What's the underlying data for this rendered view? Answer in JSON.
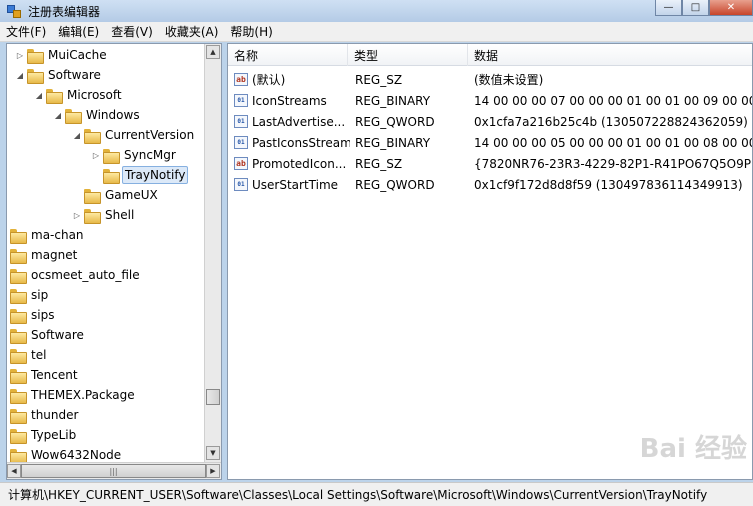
{
  "window": {
    "title": "注册表编辑器",
    "min": "—",
    "max": "□",
    "close": "✕"
  },
  "menu": [
    "文件(F)",
    "编辑(E)",
    "查看(V)",
    "收藏夹(A)",
    "帮助(H)"
  ],
  "tree": [
    {
      "label": "MuiCache",
      "expander": "▷"
    },
    {
      "label": "Software",
      "expander": "◢"
    },
    {
      "label": "Microsoft",
      "expander": "◢"
    },
    {
      "label": "Windows",
      "expander": "◢"
    },
    {
      "label": "CurrentVersion",
      "expander": "◢"
    },
    {
      "label": "SyncMgr",
      "expander": "▷"
    },
    {
      "label": "TrayNotify",
      "expander": ""
    },
    {
      "label": "GameUX",
      "expander": ""
    },
    {
      "label": "Shell",
      "expander": "▷"
    },
    {
      "label": "ma-chan",
      "expander": ""
    },
    {
      "label": "magnet",
      "expander": ""
    },
    {
      "label": "ocsmeet_auto_file",
      "expander": ""
    },
    {
      "label": "sip",
      "expander": ""
    },
    {
      "label": "sips",
      "expander": ""
    },
    {
      "label": "Software",
      "expander": ""
    },
    {
      "label": "tel",
      "expander": ""
    },
    {
      "label": "Tencent",
      "expander": ""
    },
    {
      "label": "THEMEX.Package",
      "expander": ""
    },
    {
      "label": "thunder",
      "expander": ""
    },
    {
      "label": "TypeLib",
      "expander": ""
    },
    {
      "label": "Wow6432Node",
      "expander": ""
    }
  ],
  "list": {
    "headers": {
      "name": "名称",
      "type": "类型",
      "data": "数据"
    },
    "rows": [
      {
        "icon": "ab",
        "name": "(默认)",
        "type": "REG_SZ",
        "data": "(数值未设置)"
      },
      {
        "icon": "01",
        "name": "IconStreams",
        "type": "REG_BINARY",
        "data": "14 00 00 00 07 00 00 00 01 00 01 00 09 00 00..."
      },
      {
        "icon": "01",
        "name": "LastAdvertise...",
        "type": "REG_QWORD",
        "data": "0x1cfa7a216b25c4b (130507228824362059)"
      },
      {
        "icon": "01",
        "name": "PastIconsStream",
        "type": "REG_BINARY",
        "data": "14 00 00 00 05 00 00 00 01 00 01 00 08 00 00..."
      },
      {
        "icon": "ab",
        "name": "PromotedIcon...",
        "type": "REG_SZ",
        "data": "{7820NR76-23R3-4229-82P1-R41PO67Q5O9P}..."
      },
      {
        "icon": "01",
        "name": "UserStartTime",
        "type": "REG_QWORD",
        "data": "0x1cf9f172d8d8f59 (130497836114349913)"
      }
    ]
  },
  "status": "计算机\\HKEY_CURRENT_USER\\Software\\Classes\\Local Settings\\Software\\Microsoft\\Windows\\CurrentVersion\\TrayNotify",
  "watermark": "Bai 经验",
  "scroll": {
    "up": "▲",
    "down": "▼",
    "left": "◀",
    "right": "▶",
    "grip": "|||"
  }
}
